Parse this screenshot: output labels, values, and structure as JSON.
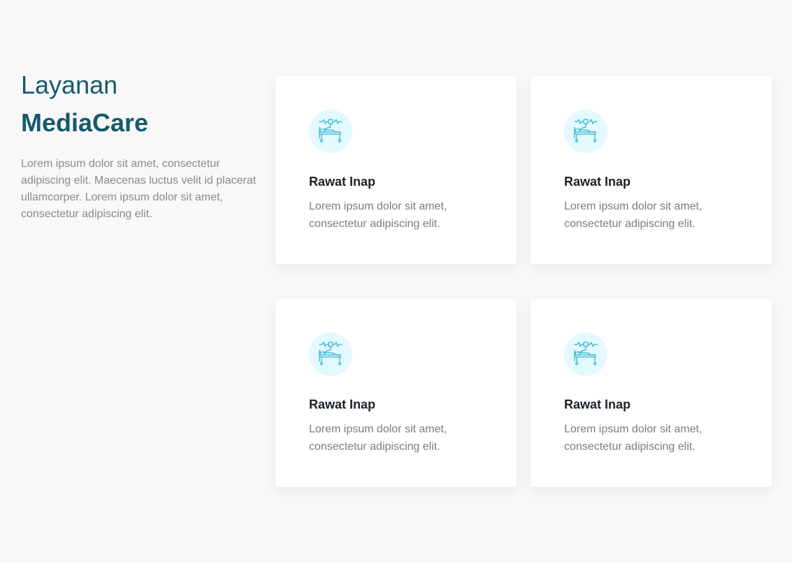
{
  "intro": {
    "title": "Layanan",
    "brand": "MediaCare",
    "description": "Lorem ipsum dolor sit amet, consectetur adipiscing elit. Maecenas luctus velit id placerat ullamcorper. Lorem ipsum dolor sit amet, consectetur adipiscing elit."
  },
  "services": [
    {
      "icon": "hospital-bed-icon",
      "title": "Rawat Inap",
      "description": "Lorem ipsum dolor sit amet, consectetur adipiscing elit."
    },
    {
      "icon": "hospital-bed-icon",
      "title": "Rawat Inap",
      "description": "Lorem ipsum dolor sit amet, consectetur adipiscing elit."
    },
    {
      "icon": "hospital-bed-icon",
      "title": "Rawat Inap",
      "description": "Lorem ipsum dolor sit amet, consectetur adipiscing elit."
    },
    {
      "icon": "hospital-bed-icon",
      "title": "Rawat Inap",
      "description": "Lorem ipsum dolor sit amet, consectetur adipiscing elit."
    }
  ],
  "colors": {
    "background": "#f8f8f8",
    "heading": "#155a6b",
    "icon_bg": "#e3f9fd",
    "icon_stroke": "#2ab3cf",
    "body_text": "#8a8a8a"
  }
}
